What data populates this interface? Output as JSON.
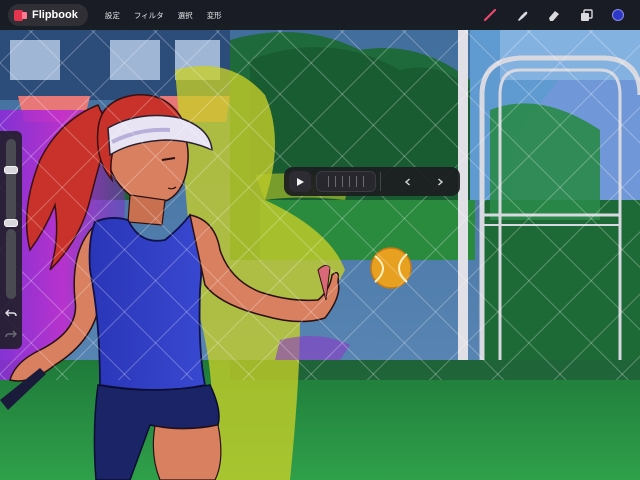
{
  "app": {
    "name": "Flipbook",
    "logo_color": "#e5344e"
  },
  "menu": {
    "items": [
      {
        "id": "settings",
        "label": "設定"
      },
      {
        "id": "filter",
        "label": "フィルタ"
      },
      {
        "id": "select",
        "label": "選択"
      },
      {
        "id": "transform",
        "label": "変形"
      }
    ]
  },
  "tools": [
    {
      "name": "brush-icon",
      "active": true,
      "color": "#e8486a"
    },
    {
      "name": "smudge-icon",
      "active": false,
      "color": "#d9d9de"
    },
    {
      "name": "eraser-icon",
      "active": false,
      "color": "#d9d9de"
    },
    {
      "name": "layers-icon",
      "active": false,
      "color": "#d9d9de"
    }
  ],
  "current_color": "#2e38c8",
  "sidebar": {
    "brush_size_level": 0.9,
    "brush_opacity_level": 0.55,
    "undo_icon": "undo-icon",
    "redo_icon": "redo-icon"
  },
  "playback": {
    "play_icon": "play-icon",
    "prev_icon": "chevron-left-icon",
    "next_icon": "chevron-right-icon",
    "frame_strip_ticks": 6
  },
  "colors": {
    "toolbar_bg": "#16161a",
    "grass": "#2a8a3e",
    "hedge": "#1e6a3a",
    "shirt": "#2f3ec4",
    "skin": "#d98060",
    "hair": "#c8322a",
    "visor": "#e8e4f4",
    "ball": "#e8a020",
    "magenta_glow": "#c030d0",
    "yellow_glow": "#c8d028"
  }
}
